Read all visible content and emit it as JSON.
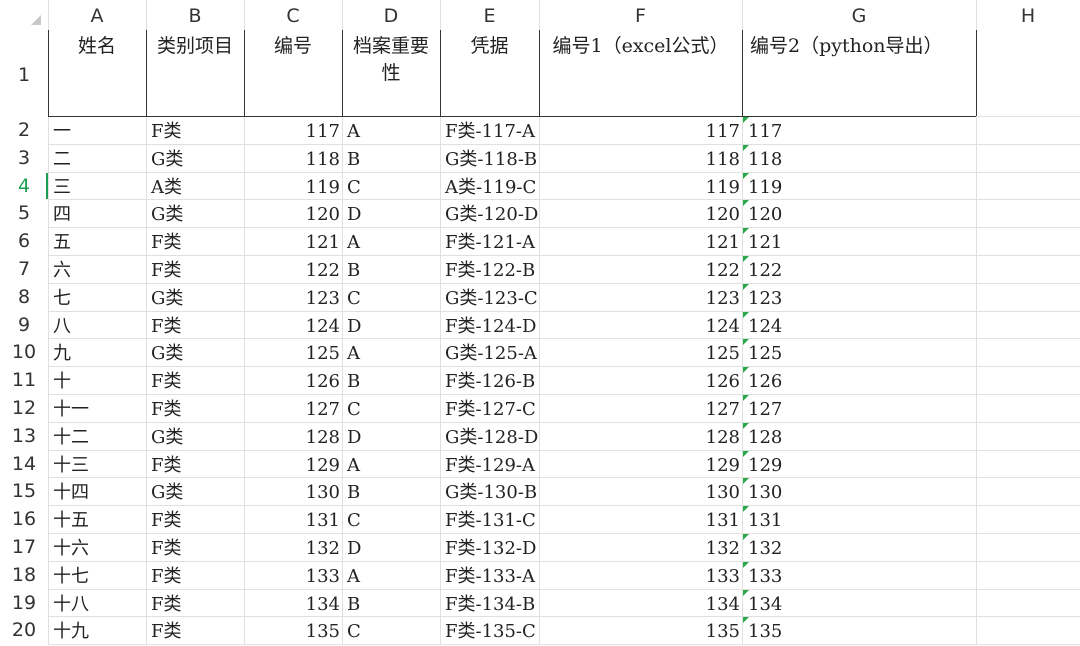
{
  "columns": [
    "A",
    "B",
    "C",
    "D",
    "E",
    "F",
    "G",
    "H"
  ],
  "headers": {
    "name": "姓名",
    "category": "类别项目",
    "number": "编号",
    "importance": "档案重要性",
    "voucher": "凭据",
    "number1": "编号1（excel公式）",
    "number2": "编号2（python导出）"
  },
  "rows": [
    {
      "row": "2",
      "name": "一",
      "category": "F类",
      "number": "117",
      "importance": "A",
      "voucher": "F类-117-A",
      "number1": "117",
      "number2": "117"
    },
    {
      "row": "3",
      "name": "二",
      "category": "G类",
      "number": "118",
      "importance": "B",
      "voucher": "G类-118-B",
      "number1": "118",
      "number2": "118"
    },
    {
      "row": "4",
      "name": "三",
      "category": "A类",
      "number": "119",
      "importance": "C",
      "voucher": "A类-119-C",
      "number1": "119",
      "number2": "119"
    },
    {
      "row": "5",
      "name": "四",
      "category": "G类",
      "number": "120",
      "importance": "D",
      "voucher": "G类-120-D",
      "number1": "120",
      "number2": "120"
    },
    {
      "row": "6",
      "name": "五",
      "category": "F类",
      "number": "121",
      "importance": "A",
      "voucher": "F类-121-A",
      "number1": "121",
      "number2": "121"
    },
    {
      "row": "7",
      "name": "六",
      "category": "F类",
      "number": "122",
      "importance": "B",
      "voucher": "F类-122-B",
      "number1": "122",
      "number2": "122"
    },
    {
      "row": "8",
      "name": "七",
      "category": "G类",
      "number": "123",
      "importance": "C",
      "voucher": "G类-123-C",
      "number1": "123",
      "number2": "123"
    },
    {
      "row": "9",
      "name": "八",
      "category": "F类",
      "number": "124",
      "importance": "D",
      "voucher": "F类-124-D",
      "number1": "124",
      "number2": "124"
    },
    {
      "row": "10",
      "name": "九",
      "category": "G类",
      "number": "125",
      "importance": "A",
      "voucher": "G类-125-A",
      "number1": "125",
      "number2": "125"
    },
    {
      "row": "11",
      "name": "十",
      "category": "F类",
      "number": "126",
      "importance": "B",
      "voucher": "F类-126-B",
      "number1": "126",
      "number2": "126"
    },
    {
      "row": "12",
      "name": "十一",
      "category": "F类",
      "number": "127",
      "importance": "C",
      "voucher": "F类-127-C",
      "number1": "127",
      "number2": "127"
    },
    {
      "row": "13",
      "name": "十二",
      "category": "G类",
      "number": "128",
      "importance": "D",
      "voucher": "G类-128-D",
      "number1": "128",
      "number2": "128"
    },
    {
      "row": "14",
      "name": "十三",
      "category": "F类",
      "number": "129",
      "importance": "A",
      "voucher": "F类-129-A",
      "number1": "129",
      "number2": "129"
    },
    {
      "row": "15",
      "name": "十四",
      "category": "G类",
      "number": "130",
      "importance": "B",
      "voucher": "G类-130-B",
      "number1": "130",
      "number2": "130"
    },
    {
      "row": "16",
      "name": "十五",
      "category": "F类",
      "number": "131",
      "importance": "C",
      "voucher": "F类-131-C",
      "number1": "131",
      "number2": "131"
    },
    {
      "row": "17",
      "name": "十六",
      "category": "F类",
      "number": "132",
      "importance": "D",
      "voucher": "F类-132-D",
      "number1": "132",
      "number2": "132"
    },
    {
      "row": "18",
      "name": "十七",
      "category": "F类",
      "number": "133",
      "importance": "A",
      "voucher": "F类-133-A",
      "number1": "133",
      "number2": "133"
    },
    {
      "row": "19",
      "name": "十八",
      "category": "F类",
      "number": "134",
      "importance": "B",
      "voucher": "F类-134-B",
      "number1": "134",
      "number2": "134"
    },
    {
      "row": "20",
      "name": "十九",
      "category": "F类",
      "number": "135",
      "importance": "C",
      "voucher": "F类-135-C",
      "number1": "135",
      "number2": "135"
    }
  ],
  "header_row_label": "1",
  "active_row": "4",
  "colors": {
    "accent": "#1a9e52",
    "grid": "#e0e0e0",
    "text_flag": "#2aa84a"
  }
}
